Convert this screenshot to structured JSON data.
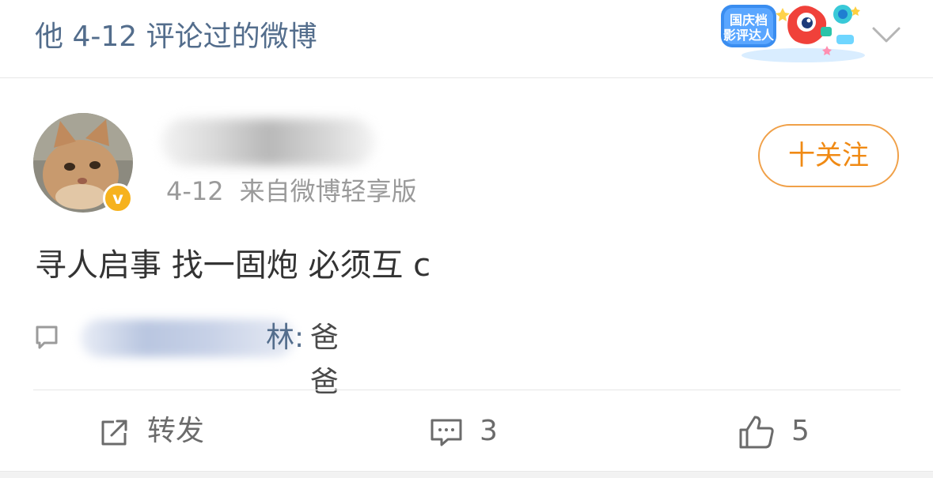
{
  "header": {
    "title": "他 4-12 评论过的微博",
    "badge_text_line1": "国庆档",
    "badge_text_line2": "影评达人",
    "chevron_icon": "chevron-down-icon"
  },
  "post": {
    "avatar_icon": "cat-avatar",
    "verified_label": "v",
    "time": "4-12",
    "source": "来自微博轻享版",
    "follow_label": "十关注",
    "text": "寻人启事 找一固炮 必须互 c"
  },
  "comment": {
    "user_visible_tail": "林",
    "text": "爸爸"
  },
  "actions": {
    "repost_label": "转发",
    "comment_count": "3",
    "like_count": "5"
  },
  "colors": {
    "link_blue": "#536d8c",
    "follow_orange": "#f08a14",
    "verified_gold": "#f6b21d"
  }
}
